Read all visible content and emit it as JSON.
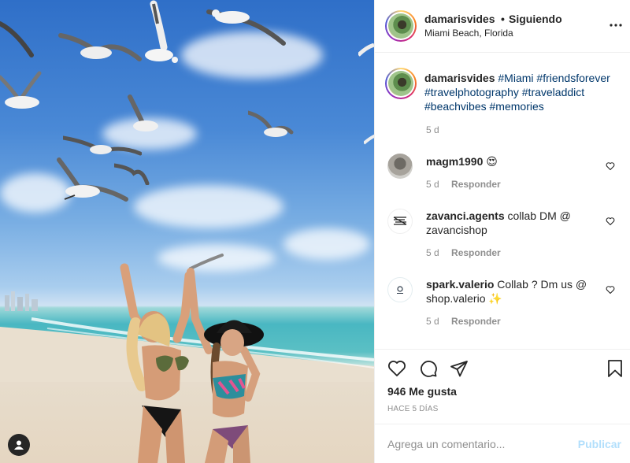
{
  "post": {
    "image_alt": "Two women on a beach with seagulls",
    "header": {
      "username": "damarisvides",
      "separator": "•",
      "follow_status": "Siguiendo",
      "location": "Miami Beach, Florida",
      "more_icon": "more-options-icon"
    },
    "caption": {
      "username": "damarisvides",
      "hashtags": [
        "#Miami",
        "#friendsforever",
        "#travelphotography",
        "#traveladdict",
        "#beachvibes",
        "#memories"
      ],
      "time": "5 d"
    },
    "comments": [
      {
        "username": "magm1990",
        "text": "😍",
        "time": "5 d",
        "reply_label": "Responder"
      },
      {
        "username": "zavanci.agents",
        "text": "collab DM @ zavancishop",
        "time": "5 d",
        "reply_label": "Responder"
      },
      {
        "username": "spark.valerio",
        "text": "Collab ? Dm us @ shop.valerio ✨",
        "time": "5 d",
        "reply_label": "Responder"
      }
    ],
    "likes": "946 Me gusta",
    "posted_ago": "HACE 5 DÍAS",
    "add_comment": {
      "placeholder": "Agrega un comentario...",
      "publish_label": "Publicar"
    }
  },
  "colors": {
    "text": "#262626",
    "secondary": "#8e8e8e",
    "link": "#00376b",
    "publish_disabled": "#b2dffc",
    "border": "#efefef"
  }
}
